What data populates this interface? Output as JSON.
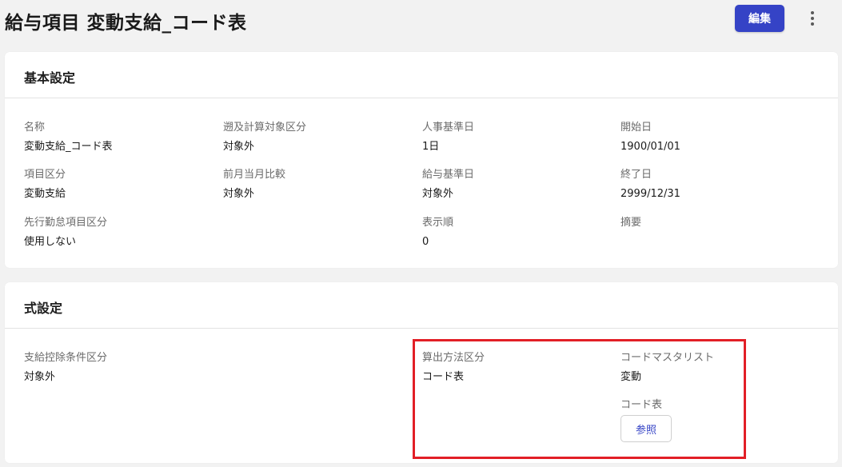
{
  "header": {
    "title": "給与項目 変動支給_コード表",
    "edit_label": "編集"
  },
  "basic_settings": {
    "title": "基本設定",
    "fields": [
      {
        "label": "名称",
        "value": "変動支給_コード表"
      },
      {
        "label": "遡及計算対象区分",
        "value": "対象外"
      },
      {
        "label": "人事基準日",
        "value": "1日"
      },
      {
        "label": "開始日",
        "value": "1900/01/01"
      },
      {
        "label": "項目区分",
        "value": "変動支給"
      },
      {
        "label": "前月当月比較",
        "value": "対象外"
      },
      {
        "label": "給与基準日",
        "value": "対象外"
      },
      {
        "label": "終了日",
        "value": "2999/12/31"
      },
      {
        "label": "先行勤怠項目区分",
        "value": "使用しない"
      },
      {
        "label": "表示順",
        "value": "0"
      },
      {
        "label": "摘要",
        "value": ""
      }
    ]
  },
  "formula_settings": {
    "title": "式設定",
    "fields": [
      {
        "label": "支給控除条件区分",
        "value": "対象外"
      },
      {
        "label": "算出方法区分",
        "value": "コード表"
      },
      {
        "label": "コードマスタリスト",
        "value": "変動"
      },
      {
        "label": "コード表",
        "value": ""
      }
    ],
    "reference_label": "参照"
  },
  "colors": {
    "primary": "#3543c6",
    "highlight": "#e21f26",
    "background": "#f2f2f2"
  },
  "icons": {
    "more": "more-vertical-icon"
  }
}
